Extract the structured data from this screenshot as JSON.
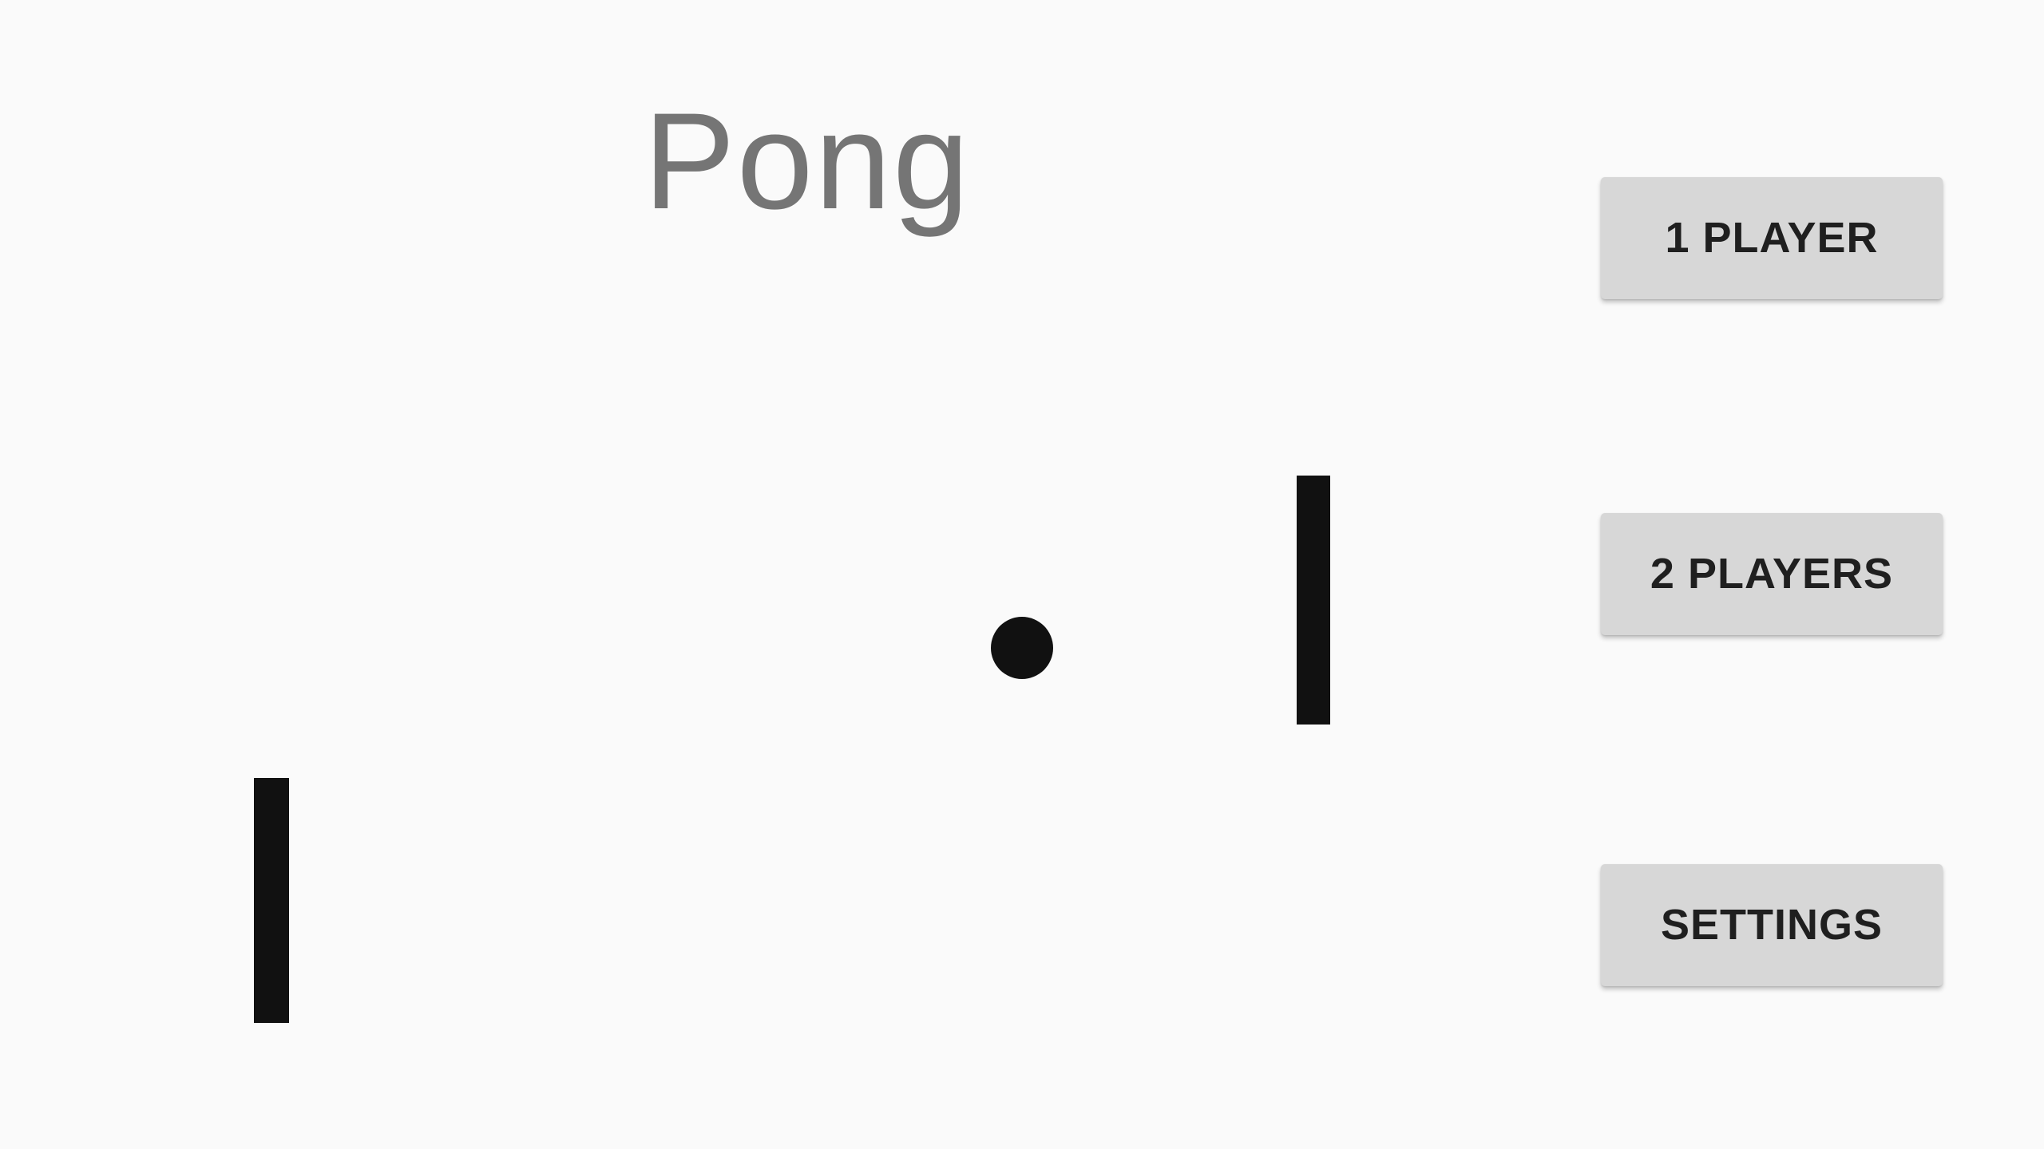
{
  "screen": {
    "title": "Pong",
    "background_color": "#fafafa",
    "title_color": "#757575",
    "game_piece_color": "#111111"
  },
  "menu": {
    "one_player_label": "1 PLAYER",
    "two_players_label": "2 PLAYERS",
    "settings_label": "SETTINGS",
    "button_color": "#d7d7d7",
    "button_text_color": "#1f1f1f"
  }
}
